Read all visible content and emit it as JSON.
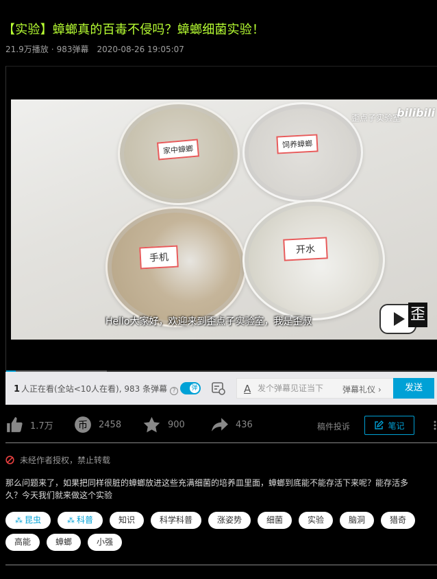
{
  "video": {
    "title": "【实验】蟑螂真的百毒不侵吗？蟑螂细菌实验！",
    "plays": "21.9万播放",
    "danmaku_count": "983弹幕",
    "date": "2020-08-26 19:05:07",
    "watermark": "歪点子实验室",
    "watermark_logo": "bilibili",
    "subtitle": "Hello大家好，欢迎来到歪点子实验室，我是歪叔",
    "badge_char": "歪",
    "plate_labels": [
      "家中蟑螂",
      "饲养蟑螂",
      "手机",
      "开水"
    ],
    "progress": 0.022
  },
  "danmaku_bar": {
    "viewer_number": "1",
    "viewer_text": "人正在看(全站<10人在看), 983 条弹幕",
    "toggle_label": "弹",
    "input_placeholder": "发个弹幕见证当下",
    "etiquette_label": "弹幕礼仪",
    "send_label": "发送"
  },
  "actions": {
    "like_count": "1.7万",
    "coin_count": "2458",
    "favorite_count": "900",
    "share_count": "436",
    "complaint_label": "稿件投诉",
    "note_label": "笔记"
  },
  "copyright_notice": "未经作者授权，禁止转载",
  "description": "那么问题来了，如果把同样很脏的蟑螂放进这些充满细菌的培养皿里面，蟑螂到底能不能存活下来呢？能存活多久？今天我们就来做这个实验",
  "tags": [
    "昆虫",
    "科普",
    "知识",
    "科学科普",
    "涨姿势",
    "细菌",
    "实验",
    "脑洞",
    "猎奇",
    "高能",
    "蟑螂",
    "小强"
  ],
  "colors": {
    "title": "#b8ff33",
    "accent": "#00a1d6",
    "background": "#000000"
  }
}
